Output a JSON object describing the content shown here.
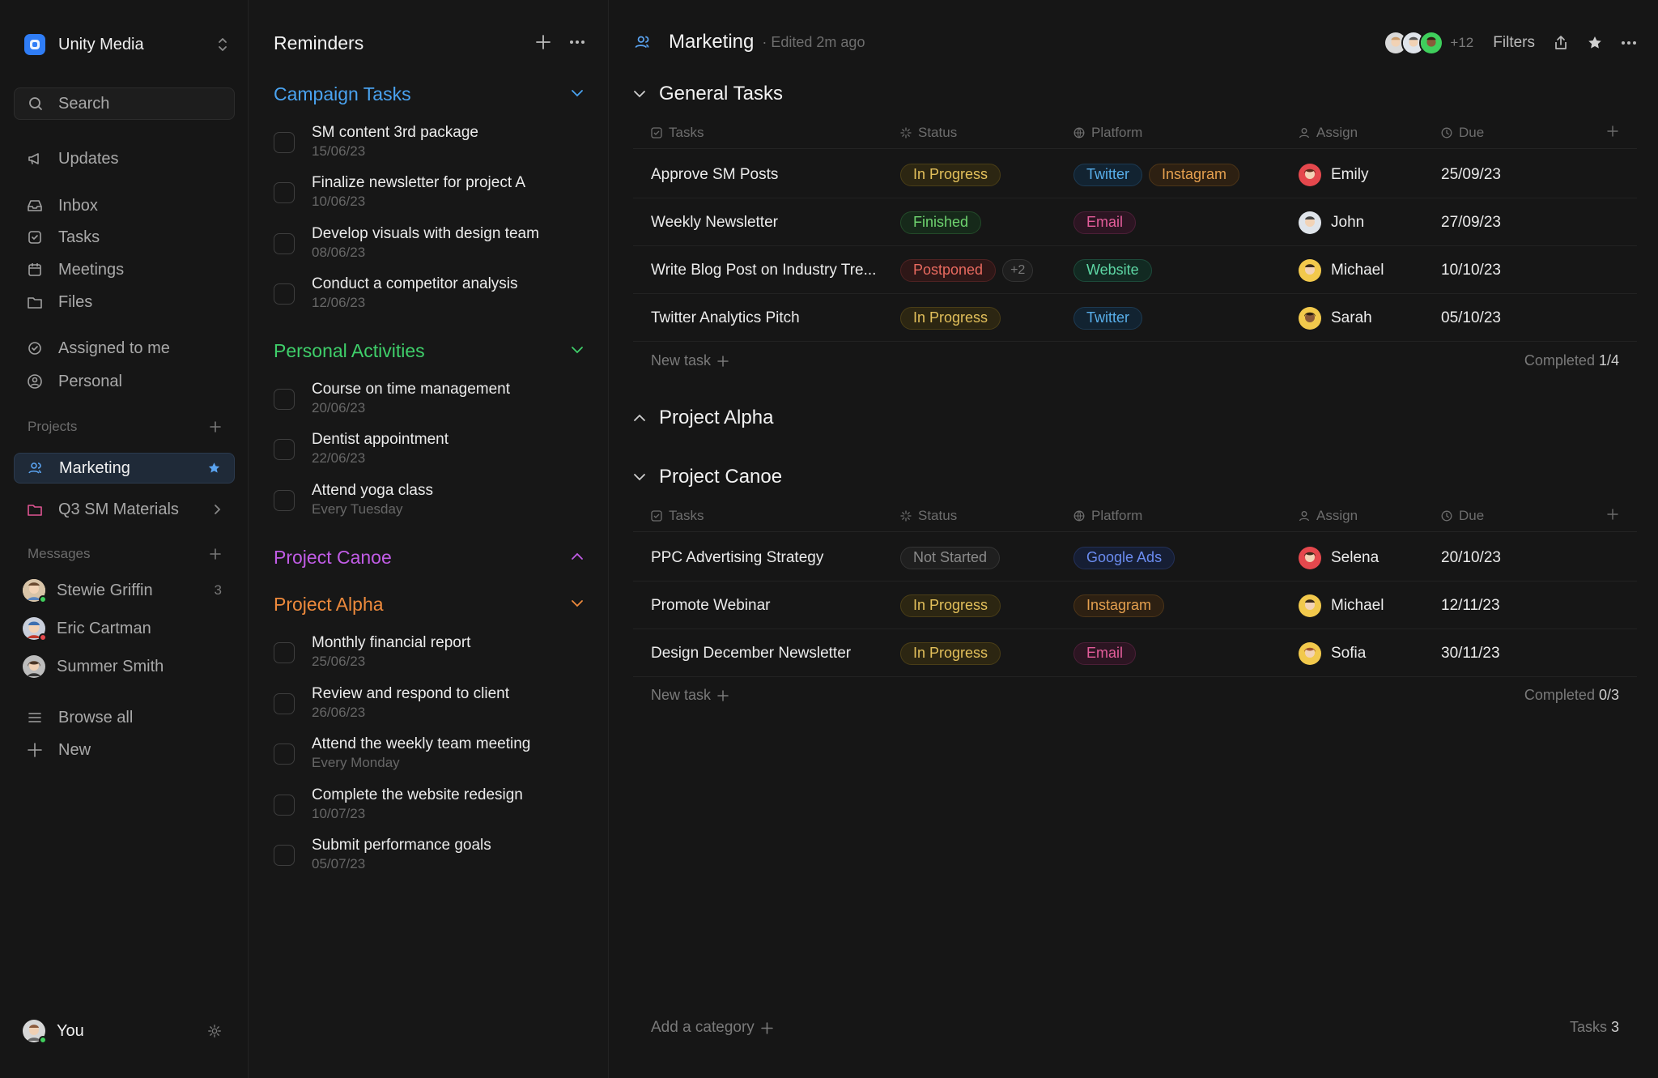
{
  "workspace": {
    "name": "Unity Media"
  },
  "sidebar": {
    "search_label": "Search",
    "updates": "Updates",
    "nav": [
      {
        "label": "Inbox",
        "icon": "inbox-icon"
      },
      {
        "label": "Tasks",
        "icon": "tasks-icon"
      },
      {
        "label": "Meetings",
        "icon": "calendar-icon"
      },
      {
        "label": "Files",
        "icon": "folder-icon"
      }
    ],
    "assigned": "Assigned to me",
    "personal": "Personal",
    "projects_heading": "Projects",
    "projects": [
      {
        "label": "Marketing",
        "active": true
      },
      {
        "label": "Q3 SM Materials",
        "active": false
      }
    ],
    "messages_heading": "Messages",
    "messages": [
      {
        "name": "Stewie Griffin",
        "count": "3",
        "status_color": "#3fcf5c"
      },
      {
        "name": "Eric Cartman",
        "count": "",
        "status_color": "#e5484d"
      },
      {
        "name": "Summer Smith",
        "count": "",
        "status_color": ""
      }
    ],
    "browse_all": "Browse all",
    "new_label": "New",
    "user": {
      "name": "You",
      "status_color": "#3fcf5c"
    }
  },
  "reminders": {
    "title": "Reminders",
    "groups": [
      {
        "title": "Campaign Tasks",
        "color": "#4aa3f0",
        "expanded": true,
        "items": [
          {
            "title": "SM content 3rd package",
            "date": "15/06/23"
          },
          {
            "title": "Finalize newsletter for project A",
            "date": "10/06/23"
          },
          {
            "title": "Develop visuals with design team",
            "date": "08/06/23"
          },
          {
            "title": "Conduct a competitor analysis",
            "date": "12/06/23"
          }
        ]
      },
      {
        "title": "Personal Activities",
        "color": "#3fcf6a",
        "expanded": true,
        "items": [
          {
            "title": "Course on time management",
            "date": "20/06/23"
          },
          {
            "title": "Dentist appointment",
            "date": "22/06/23"
          },
          {
            "title": "Attend yoga class",
            "date": "Every Tuesday"
          }
        ]
      },
      {
        "title": "Project Canoe",
        "color": "#c15ce6",
        "expanded": false,
        "items": []
      },
      {
        "title": "Project Alpha",
        "color": "#ee8a3c",
        "expanded": true,
        "items": [
          {
            "title": "Monthly financial report",
            "date": "25/06/23"
          },
          {
            "title": "Review and respond to client",
            "date": "26/06/23"
          },
          {
            "title": "Attend the weekly team meeting",
            "date": "Every Monday"
          },
          {
            "title": "Complete the website redesign",
            "date": "10/07/23"
          },
          {
            "title": "Submit performance goals",
            "date": "05/07/23"
          }
        ]
      }
    ]
  },
  "main": {
    "title": "Marketing",
    "edited": "Edited 2m ago",
    "members_extra": "+12",
    "filters": "Filters",
    "columns": {
      "tasks": "Tasks",
      "status": "Status",
      "platform": "Platform",
      "assign": "Assign",
      "due": "Due"
    },
    "categories": [
      {
        "title": "General Tasks",
        "expanded": true,
        "rows": [
          {
            "task": "Approve SM Posts",
            "status": "In Progress",
            "status_kind": "prog",
            "status_more": "",
            "platforms": [
              {
                "label": "Twitter",
                "kind": "tw"
              },
              {
                "label": "Instagram",
                "kind": "ig"
              }
            ],
            "assignee": "Emily",
            "due": "25/09/23"
          },
          {
            "task": "Weekly Newsletter",
            "status": "Finished",
            "status_kind": "fin",
            "status_more": "",
            "platforms": [
              {
                "label": "Email",
                "kind": "em"
              }
            ],
            "assignee": "John",
            "due": "27/09/23"
          },
          {
            "task": "Write Blog Post on Industry Tre...",
            "status": "Postponed",
            "status_kind": "post",
            "status_more": "+2",
            "platforms": [
              {
                "label": "Website",
                "kind": "web"
              }
            ],
            "assignee": "Michael",
            "due": "10/10/23"
          },
          {
            "task": "Twitter Analytics Pitch",
            "status": "In Progress",
            "status_kind": "prog",
            "status_more": "",
            "platforms": [
              {
                "label": "Twitter",
                "kind": "tw"
              }
            ],
            "assignee": "Sarah",
            "due": "05/10/23"
          }
        ],
        "new_task": "New task",
        "completed_label": "Completed",
        "completed_value": "1/4"
      },
      {
        "title": "Project Alpha",
        "expanded": false,
        "rows": []
      },
      {
        "title": "Project Canoe",
        "expanded": true,
        "rows": [
          {
            "task": "PPC Advertising Strategy",
            "status": "Not Started",
            "status_kind": "not",
            "status_more": "",
            "platforms": [
              {
                "label": "Google Ads",
                "kind": "ga"
              }
            ],
            "assignee": "Selena",
            "due": "20/10/23"
          },
          {
            "task": "Promote Webinar",
            "status": "In Progress",
            "status_kind": "prog",
            "status_more": "",
            "platforms": [
              {
                "label": "Instagram",
                "kind": "ig"
              }
            ],
            "assignee": "Michael",
            "due": "12/11/23"
          },
          {
            "task": "Design December Newsletter",
            "status": "In Progress",
            "status_kind": "prog",
            "status_more": "",
            "platforms": [
              {
                "label": "Email",
                "kind": "em"
              }
            ],
            "assignee": "Sofia",
            "due": "30/11/23"
          }
        ],
        "new_task": "New task",
        "completed_label": "Completed",
        "completed_value": "0/3"
      }
    ],
    "add_category": "Add a category",
    "tasks_label": "Tasks",
    "tasks_count": "3"
  }
}
